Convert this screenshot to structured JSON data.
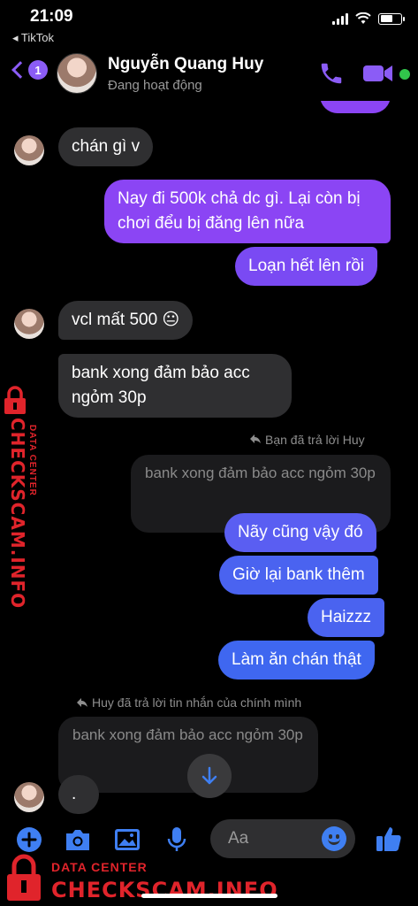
{
  "status_bar": {
    "time": "21:09",
    "back_app": "◂ TikTok"
  },
  "header": {
    "back_count": "1",
    "name": "Nguyễn Quang Huy",
    "status": "Đang hoạt động"
  },
  "messages": {
    "m1": "chán gì v",
    "m2": "Nay đi 500k chả dc gì. Lại còn bị chơi đểu bị đăng lên nữa",
    "m3": "Loạn hết lên rồi",
    "m4": "vcl mất 500 😐",
    "m5": "bank xong đảm bảo acc ngỏm 30p",
    "reply1_note": "Bạn đã trả lời Huy",
    "reply1_quote": "bank xong đảm bảo acc ngỏm 30p",
    "m6": "Nãy cũng vậy đó",
    "m7": "Giờ lại bank thêm",
    "m8": "Haizzz",
    "m9": "Làm ăn chán thật",
    "reply2_note": "Huy đã trả lời tin nhắn của chính mình",
    "reply2_quote": "bank xong đảm bảo acc ngỏm 30p",
    "m10": "."
  },
  "composer": {
    "placeholder": "Aa"
  },
  "watermark": {
    "line1": "DATA CENTER",
    "line2": "CHECKSCAM.INFO"
  },
  "colors": {
    "accent": "#8b5cf6",
    "incoming_bubble": "#2f2f31",
    "online": "#31c44b",
    "watermark": "#e0242b"
  },
  "icons": [
    "back-chevron-icon",
    "phone-icon",
    "video-camera-icon",
    "plus-icon",
    "camera-icon",
    "image-icon",
    "microphone-icon",
    "emoji-icon",
    "thumbs-up-icon",
    "reply-arrow-icon",
    "arrow-down-icon",
    "lock-icon"
  ]
}
